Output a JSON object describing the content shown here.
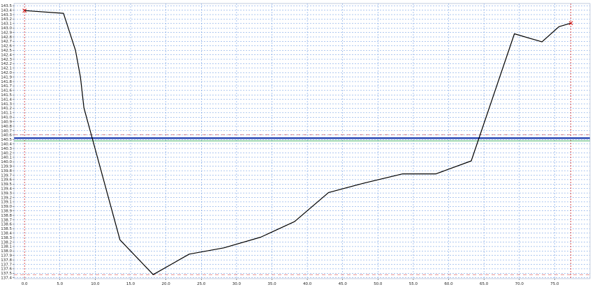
{
  "chart_data": {
    "type": "line",
    "title": "",
    "xlabel": "",
    "ylabel": "",
    "corner_label": "",
    "xlim": [
      -1.5,
      80
    ],
    "ylim": [
      137.38,
      143.55
    ],
    "x_ticks": [
      0,
      5,
      10,
      15,
      20,
      25,
      30,
      35,
      40,
      45,
      50,
      55,
      60,
      65,
      70,
      75
    ],
    "x_tick_labels": [
      "0.0",
      "5.0",
      "10.0",
      "15.0",
      "20.0",
      "25.0",
      "30.0",
      "35.0",
      "40.0",
      "45.0",
      "50.0",
      "55.0",
      "60.0",
      "65.0",
      "70.0",
      "75.0"
    ],
    "y_tick_start": 137.4,
    "y_tick_end": 143.5,
    "y_tick_step": 0.1,
    "y_tick_decimals": 1,
    "grid": true,
    "colors": {
      "profile": "#000000",
      "water_level": "#1f3fb0",
      "level_secondary": "#2fa84f",
      "limit_dashed": "#e07070",
      "grid": "#5b8fe0",
      "marker": "#d01010"
    },
    "series": [
      {
        "role": "profile",
        "x": [
          0.0,
          5.5,
          7.2,
          7.9,
          8.4,
          13.5,
          18.2,
          23.3,
          28.2,
          33.4,
          38.2,
          43.0,
          48.2,
          53.5,
          58.2,
          63.2,
          69.3,
          73.2,
          75.6,
          77.3
        ],
        "y": [
          143.39,
          143.33,
          142.5,
          141.9,
          141.21,
          138.25,
          137.47,
          137.93,
          138.07,
          138.31,
          138.66,
          139.31,
          139.53,
          139.73,
          139.73,
          140.02,
          142.87,
          142.69,
          143.03,
          143.11
        ]
      }
    ],
    "end_markers": [
      {
        "x": 0.0,
        "y": 143.39
      },
      {
        "x": 77.3,
        "y": 143.11
      }
    ],
    "horizontal_lines": [
      {
        "role": "water_level",
        "y": 140.53
      },
      {
        "role": "level_secondary",
        "y": 140.47
      },
      {
        "role": "limit_dashed",
        "y": 140.61
      },
      {
        "role": "limit_dashed",
        "y": 137.47
      }
    ],
    "vertical_dashed_lines": [
      {
        "x": 0.0
      },
      {
        "x": 77.3
      }
    ]
  }
}
